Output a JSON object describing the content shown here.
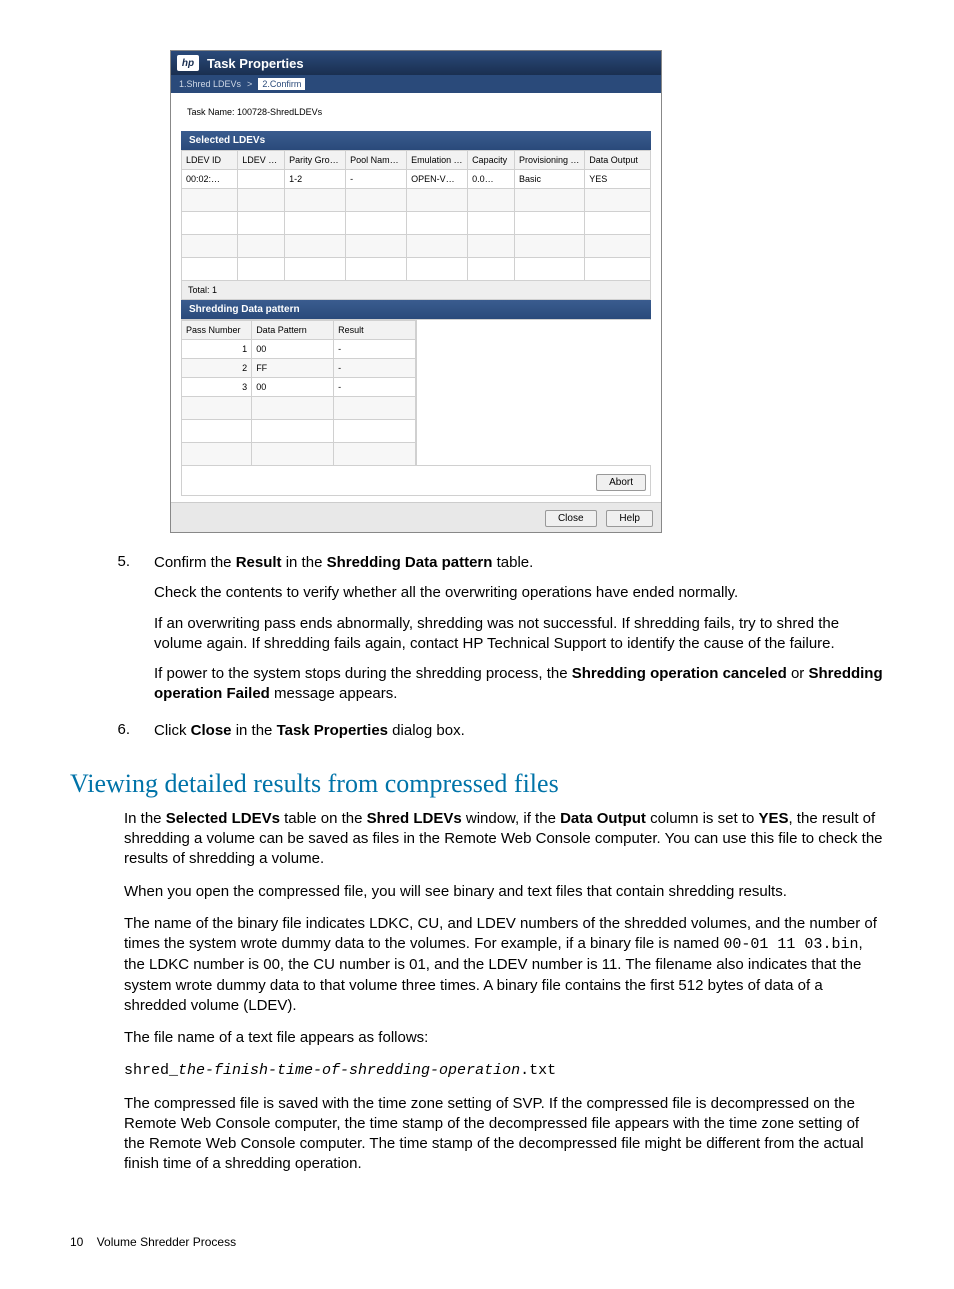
{
  "dialog": {
    "title": "Task Properties",
    "logo_text": "hp",
    "breadcrumb": {
      "step1": "1.Shred LDEVs",
      "sep": ">",
      "step2": "2.Confirm"
    },
    "task_name_label": "Task Name:",
    "task_name_value": "100728-ShredLDEVs",
    "selected_ldevs": {
      "title": "Selected LDEVs",
      "headers": [
        "LDEV ID",
        "LDEV Name",
        "Parity Group ID",
        "Pool Name(ID)",
        "Emulation Type",
        "Capacity",
        "Provisioning Type",
        "Data Output"
      ],
      "rows": [
        {
          "ldev_id": "00:02:…",
          "ldev_name": "",
          "pg": "1-2",
          "pool": "-",
          "emul": "OPEN-V…",
          "cap": "0.0…",
          "prov": "Basic",
          "dout": "YES"
        }
      ],
      "total_label": "Total: 1"
    },
    "shredding": {
      "title": "Shredding Data pattern",
      "headers": [
        "Pass Number",
        "Data Pattern",
        "Result"
      ],
      "rows": [
        {
          "pass": "1",
          "pattern": "00",
          "result": "-"
        },
        {
          "pass": "2",
          "pattern": "FF",
          "result": "-"
        },
        {
          "pass": "3",
          "pattern": "00",
          "result": "-"
        }
      ]
    },
    "buttons": {
      "abort": "Abort",
      "close": "Close",
      "help": "Help"
    }
  },
  "doc": {
    "step5": {
      "num": "5.",
      "line1_a": "Confirm the ",
      "line1_b": "Result",
      "line1_c": " in the ",
      "line1_d": "Shredding Data pattern",
      "line1_e": " table.",
      "p2": "Check the contents to verify whether all the overwriting operations have ended normally.",
      "p3": "If an overwriting pass ends abnormally, shredding was not successful. If shredding fails, try to shred the volume again. If shredding fails again, contact HP Technical Support to identify the cause of the failure.",
      "p4_a": "If power to the system stops during the shredding process, the ",
      "p4_b": "Shredding operation canceled",
      "p4_c": " or ",
      "p4_d": "Shredding operation Failed",
      "p4_e": " message appears."
    },
    "step6": {
      "num": "6.",
      "a": "Click ",
      "b": "Close",
      "c": " in the ",
      "d": "Task Properties",
      "e": " dialog box."
    },
    "h2": "Viewing detailed results from compressed files",
    "p1": {
      "a": "In the ",
      "b": "Selected LDEVs",
      "c": " table on the ",
      "d": "Shred LDEVs",
      "e": " window, if the ",
      "f": "Data Output",
      "g": " column is set to ",
      "h": "YES",
      "i": ", the result of shredding a volume can be saved as files in the Remote Web Console computer. You can use this file to check the results of shredding a volume."
    },
    "p2": "When you open the compressed file, you will see binary and text files that contain shredding results.",
    "p3": {
      "a": "The name of the binary file indicates LDKC, CU, and LDEV numbers of the shredded volumes, and the number of times the system wrote dummy data to the volumes. For example, if a binary file is named ",
      "b": "00-01 11 03.bin",
      "c": ", the LDKC number is 00, the CU number is 01, and the LDEV number is 11. The filename also indicates that the system wrote dummy data to that volume three times. A binary file contains the first 512 bytes of data of a shredded volume (LDEV)."
    },
    "p4": "The file name of a text file appears as follows:",
    "p5": {
      "a": "shred_",
      "b": "the-finish-time-of-shredding-operation",
      "c": ".txt"
    },
    "p6": "The compressed file is saved with the time zone setting of SVP. If the compressed file is decompressed on the Remote Web Console computer, the time stamp of the decompressed file appears with the time zone setting of the Remote Web Console computer. The time stamp of the decompressed file might be different from the actual finish time of a shredding operation.",
    "footer_num": "10",
    "footer_text": "Volume Shredder Process"
  }
}
